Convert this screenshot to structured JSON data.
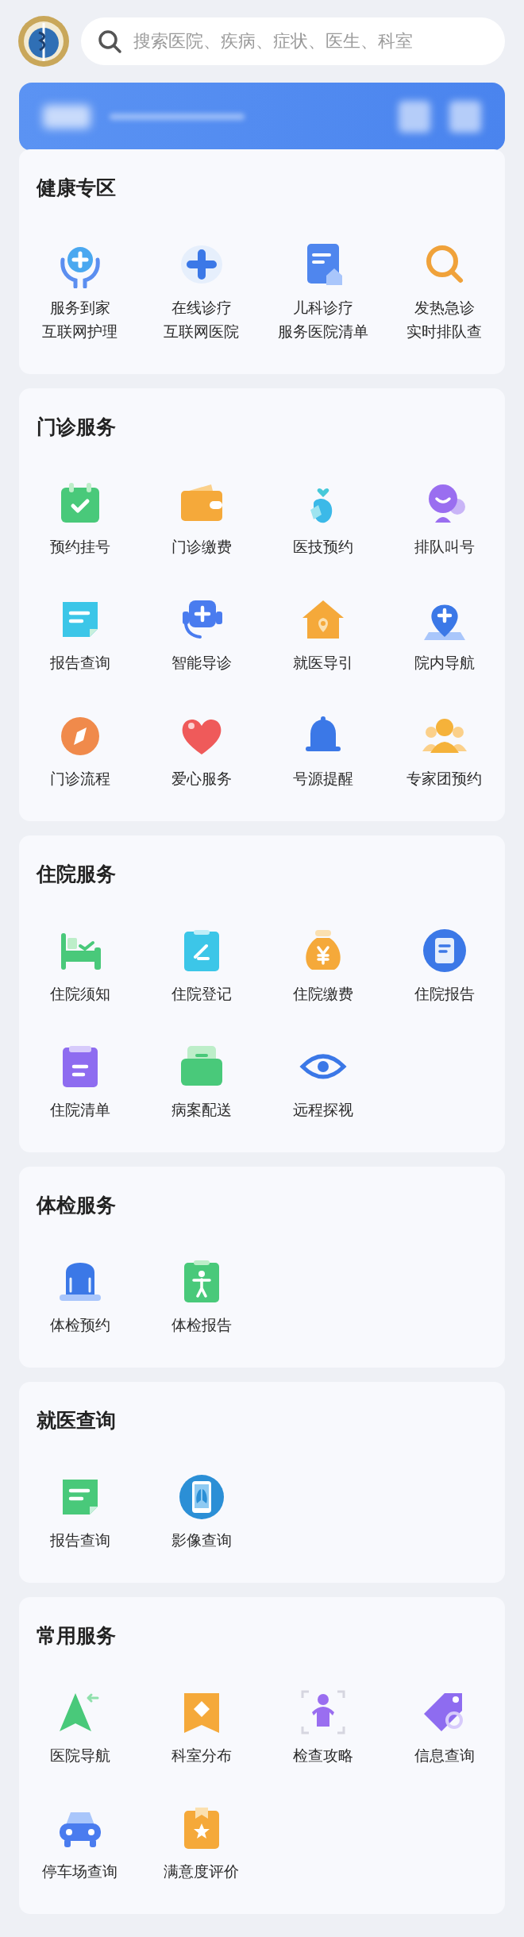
{
  "search": {
    "placeholder": "搜索医院、疾病、症状、医生、科室"
  },
  "sections": [
    {
      "title": "健康专区",
      "items": [
        {
          "label": "服务到家",
          "sublabel": "互联网护理"
        },
        {
          "label": "在线诊疗",
          "sublabel": "互联网医院"
        },
        {
          "label": "儿科诊疗",
          "sublabel": "服务医院清单"
        },
        {
          "label": "发热急诊",
          "sublabel": "实时排队查"
        }
      ]
    },
    {
      "title": "门诊服务",
      "items": [
        {
          "label": "预约挂号"
        },
        {
          "label": "门诊缴费"
        },
        {
          "label": "医技预约"
        },
        {
          "label": "排队叫号"
        },
        {
          "label": "报告查询"
        },
        {
          "label": "智能导诊"
        },
        {
          "label": "就医导引"
        },
        {
          "label": "院内导航"
        },
        {
          "label": "门诊流程"
        },
        {
          "label": "爱心服务"
        },
        {
          "label": "号源提醒"
        },
        {
          "label": "专家团预约"
        }
      ]
    },
    {
      "title": "住院服务",
      "items": [
        {
          "label": "住院须知"
        },
        {
          "label": "住院登记"
        },
        {
          "label": "住院缴费"
        },
        {
          "label": "住院报告"
        },
        {
          "label": "住院清单"
        },
        {
          "label": "病案配送"
        },
        {
          "label": "远程探视"
        }
      ]
    },
    {
      "title": "体检服务",
      "items": [
        {
          "label": "体检预约"
        },
        {
          "label": "体检报告"
        }
      ]
    },
    {
      "title": "就医查询",
      "items": [
        {
          "label": "报告查询"
        },
        {
          "label": "影像查询"
        }
      ]
    },
    {
      "title": "常用服务",
      "items": [
        {
          "label": "医院导航"
        },
        {
          "label": "科室分布"
        },
        {
          "label": "检查攻略"
        },
        {
          "label": "信息查询"
        },
        {
          "label": "停车场查询"
        },
        {
          "label": "满意度评价"
        }
      ]
    }
  ]
}
